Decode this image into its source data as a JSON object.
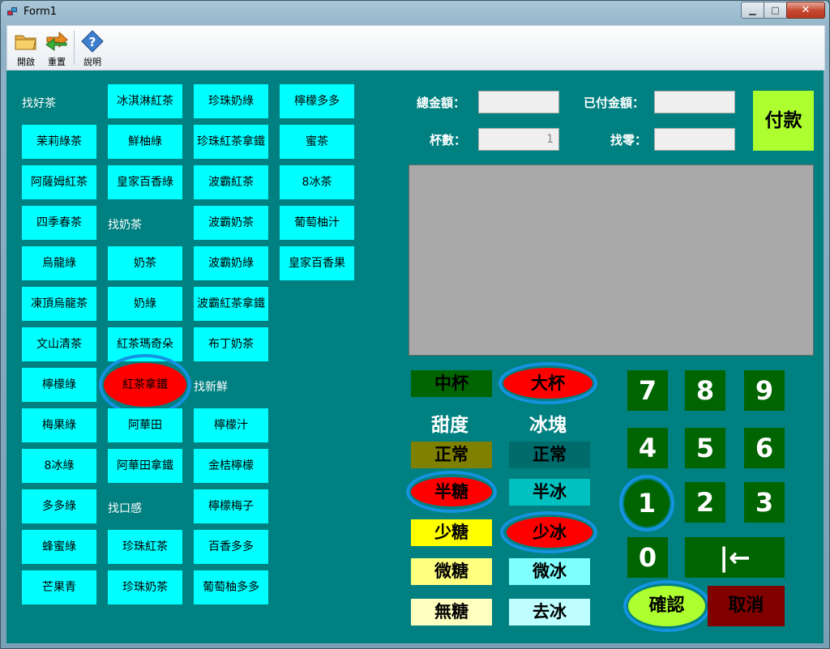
{
  "window": {
    "title": "Form1"
  },
  "toolbar": {
    "open_label": "開啟",
    "reset_label": "重置",
    "help_label": "說明"
  },
  "menu": {
    "col1": [
      "找好茶",
      "茉莉綠茶",
      "阿薩姆紅茶",
      "四季春茶",
      "烏龍綠",
      "凍頂烏龍茶",
      "文山清茶",
      "檸檬綠",
      "梅果綠",
      "8冰綠",
      "多多綠",
      "蜂蜜綠",
      "芒果青"
    ],
    "col2": [
      "冰淇淋紅茶",
      "鮮柚綠",
      "皇家百香綠",
      "找奶茶",
      "奶茶",
      "奶綠",
      "紅茶瑪奇朵",
      "紅茶拿鐵",
      "阿華田",
      "阿華田拿鐵",
      "找口感",
      "珍珠紅茶",
      "珍珠奶茶"
    ],
    "col3": [
      "珍珠奶綠",
      "珍珠紅茶拿鐵",
      "波霸紅茶",
      "波霸奶茶",
      "波霸奶綠",
      "波霸紅茶拿鐵",
      "布丁奶茶",
      "找新鮮",
      "檸檬汁",
      "金桔檸檬",
      "檸檬梅子",
      "百香多多",
      "葡萄柚多多"
    ],
    "col4": [
      "檸檬多多",
      "蜜茶",
      "8冰茶",
      "葡萄柚汁",
      "皇家百香果"
    ]
  },
  "payment": {
    "total_label": "總金額：",
    "paid_label": "已付金額：",
    "cups_label": "杯數：",
    "change_label": "找零：",
    "total_value": "",
    "paid_value": "",
    "cups_value": "1",
    "change_value": "",
    "pay_button": "付款"
  },
  "size": {
    "medium": "中杯",
    "large": "大杯"
  },
  "sweetness": {
    "caption": "甜度",
    "options": [
      "正常",
      "半糖",
      "少糖",
      "微糖",
      "無糖"
    ]
  },
  "ice": {
    "caption": "冰塊",
    "options": [
      "正常",
      "半冰",
      "少冰",
      "微冰",
      "去冰"
    ]
  },
  "keypad": {
    "keys": [
      "7",
      "8",
      "9",
      "4",
      "5",
      "6",
      "1",
      "2",
      "3",
      "0"
    ],
    "backspace": "|←",
    "confirm": "確認",
    "cancel": "取消"
  },
  "selected": {
    "drink": "紅茶拿鐵",
    "size": "大杯",
    "sweetness": "半糖",
    "ice": "少冰",
    "key": "1"
  },
  "colors": {
    "background": "#008080",
    "menu_button": "#00ffff",
    "selected": "#ff0000",
    "highlight_ring": "#1493e0",
    "pay_button": "#adff2f",
    "numpad": "#006400",
    "cancel": "#800000"
  }
}
